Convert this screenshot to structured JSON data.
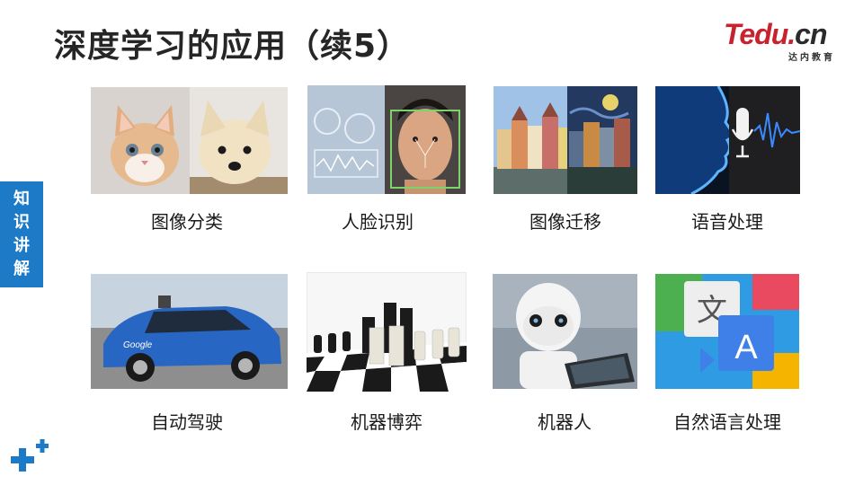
{
  "title": "深度学习的应用（续5）",
  "logo": {
    "brand_t": "T",
    "brand_rest": "edu.",
    "brand_cn": "cn",
    "subtitle": "达内教育"
  },
  "side_tab": {
    "chars": [
      "知",
      "识",
      "讲",
      "解"
    ]
  },
  "applications": [
    {
      "label": "图像分类",
      "image": "cat-and-dog-photo"
    },
    {
      "label": "人脸识别",
      "image": "face-scan-photo"
    },
    {
      "label": "图像迁移",
      "image": "style-transfer-town-photo"
    },
    {
      "label": "语音处理",
      "image": "voice-microphone-photo"
    },
    {
      "label": "自动驾驶",
      "image": "self-driving-car-photo"
    },
    {
      "label": "机器博弈",
      "image": "chess-photo"
    },
    {
      "label": "机器人",
      "image": "robot-photo"
    },
    {
      "label": "自然语言处理",
      "image": "translate-icon-photo"
    }
  ],
  "colors": {
    "accent_blue": "#1d7ac7",
    "logo_red": "#c9222f"
  },
  "icons": {
    "corner_decoration": "plus-icon"
  }
}
